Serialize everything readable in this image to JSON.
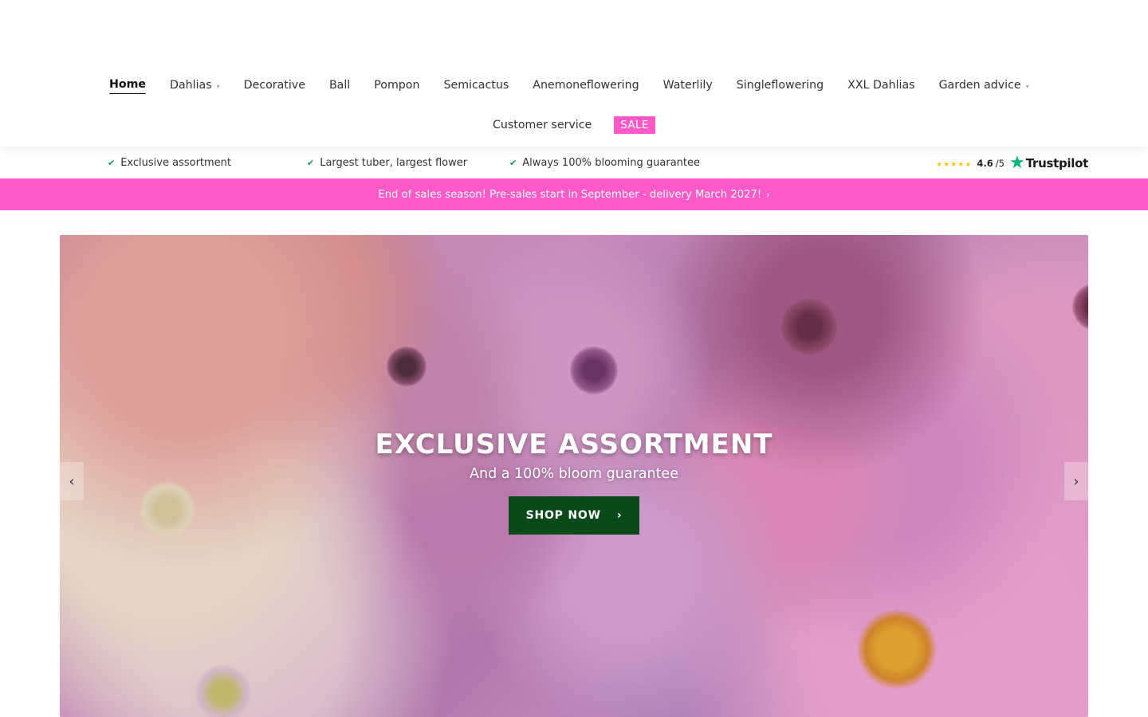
{
  "nav": {
    "row1": [
      {
        "label": "Home",
        "active": true,
        "dropdown": false
      },
      {
        "label": "Dahlias",
        "active": false,
        "dropdown": true
      },
      {
        "label": "Decorative",
        "active": false,
        "dropdown": false
      },
      {
        "label": "Ball",
        "active": false,
        "dropdown": false
      },
      {
        "label": "Pompon",
        "active": false,
        "dropdown": false
      },
      {
        "label": "Semicactus",
        "active": false,
        "dropdown": false
      },
      {
        "label": "Anemoneflowering",
        "active": false,
        "dropdown": false
      },
      {
        "label": "Waterlily",
        "active": false,
        "dropdown": false
      },
      {
        "label": "Singleflowering",
        "active": false,
        "dropdown": false
      },
      {
        "label": "XXL Dahlias",
        "active": false,
        "dropdown": false
      },
      {
        "label": "Garden advice",
        "active": false,
        "dropdown": true
      }
    ],
    "customer_service": "Customer service",
    "sale": "SALE",
    "caret_icon": "chevron-down-icon"
  },
  "usp": {
    "items": [
      {
        "label": "Exclusive assortment",
        "icon": "check-icon"
      },
      {
        "label": "Largest tuber, largest flower",
        "icon": "check-icon"
      },
      {
        "label": "Always 100% blooming guarantee",
        "icon": "check-icon"
      }
    ],
    "trustpilot": {
      "stars": "★★★★★",
      "score": "4.6",
      "outof": "/5",
      "brand_star": "★",
      "brand": "Trustpilot"
    }
  },
  "promo": {
    "text": "End of sales season! Pre-sales start in September - delivery March 2027!",
    "icon": "arrow-right-icon"
  },
  "hero": {
    "title": "EXCLUSIVE ASSORTMENT",
    "subtitle": "And a 100% bloom guarantee",
    "button": "SHOP NOW",
    "button_icon": "arrow-right-icon"
  },
  "colors": {
    "accent_pink": "#ff5ac8",
    "button_green": "#0a4a1a",
    "check_green": "#1f9a4c",
    "trustpilot_green": "#00b67a",
    "star_yellow": "#f5c518"
  }
}
